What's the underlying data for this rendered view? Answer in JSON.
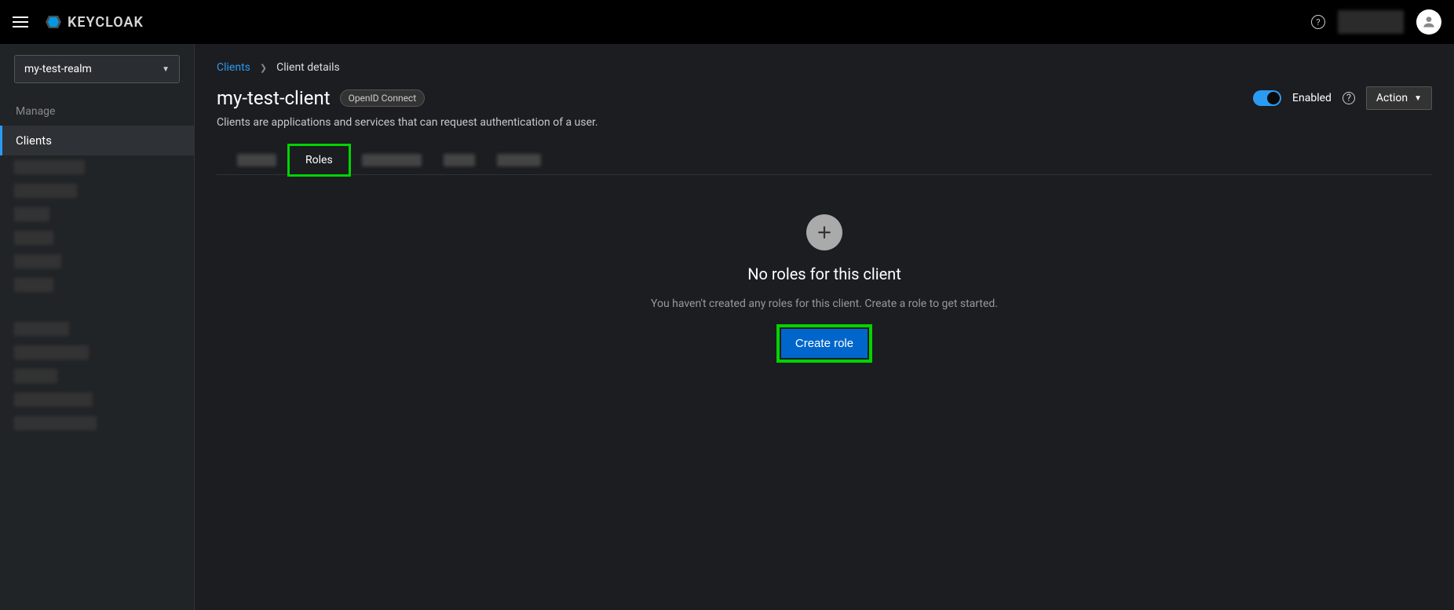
{
  "brand": "KEYCLOAK",
  "realm_selector": {
    "value": "my-test-realm"
  },
  "sidebar": {
    "section_manage": "Manage",
    "clients_label": "Clients"
  },
  "breadcrumb": {
    "root": "Clients",
    "current": "Client details"
  },
  "page": {
    "title": "my-test-client",
    "protocol": "OpenID Connect",
    "subtitle": "Clients are applications and services that can request authentication of a user.",
    "enabled_label": "Enabled",
    "action_label": "Action"
  },
  "tabs": {
    "roles": "Roles"
  },
  "empty": {
    "title": "No roles for this client",
    "desc": "You haven't created any roles for this client. Create a role to get started.",
    "button": "Create role"
  }
}
